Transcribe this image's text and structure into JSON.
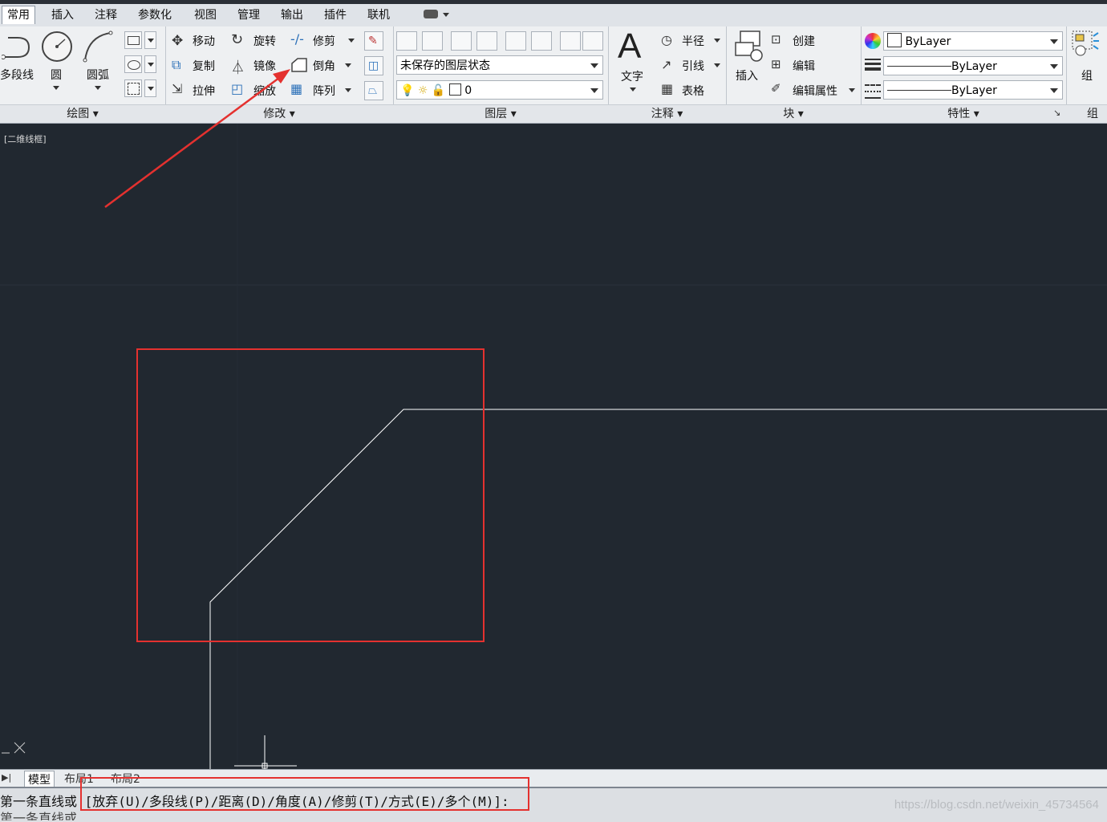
{
  "tabs": [
    "常用",
    "插入",
    "注释",
    "参数化",
    "视图",
    "管理",
    "输出",
    "插件",
    "联机"
  ],
  "draw_panel": {
    "title": "绘图",
    "polyline": "多段线",
    "circle": "圆",
    "arc": "圆弧"
  },
  "modify_panel": {
    "title": "修改",
    "move": "移动",
    "rotate": "旋转",
    "trim": "修剪",
    "copy": "复制",
    "mirror": "镜像",
    "chamfer": "倒角",
    "stretch": "拉伸",
    "scale": "缩放",
    "array": "阵列"
  },
  "layer_panel": {
    "title": "图层",
    "layer_state": "未保存的图层状态",
    "current_layer": "0"
  },
  "annotation_panel": {
    "title": "注释",
    "text": "文字",
    "radius": "半径",
    "leader": "引线",
    "table": "表格"
  },
  "block_panel": {
    "title": "块",
    "insert": "插入",
    "create": "创建",
    "edit": "编辑",
    "edit_attributes": "编辑属性"
  },
  "properties_panel": {
    "title": "特性",
    "color": "ByLayer",
    "linetype": "ByLayer",
    "lineweight": "ByLayer"
  },
  "group_panel": {
    "title": "组",
    "group": "组"
  },
  "viewport_label": "[二维线框]",
  "layout_tabs": [
    "模型",
    "布局1",
    "布局2"
  ],
  "command": {
    "line1": "第一条直线或 [放弃(U)/多段线(P)/距离(D)/角度(A)/修剪(T)/方式(E)/多个(M)]:",
    "line2_partial": "第一条直线或"
  },
  "watermark": "https://blog.csdn.net/weixin_45734564",
  "colors": {
    "canvas_bg": "#212830",
    "highlight": "#e4312f",
    "geometry": "#ffffff"
  }
}
